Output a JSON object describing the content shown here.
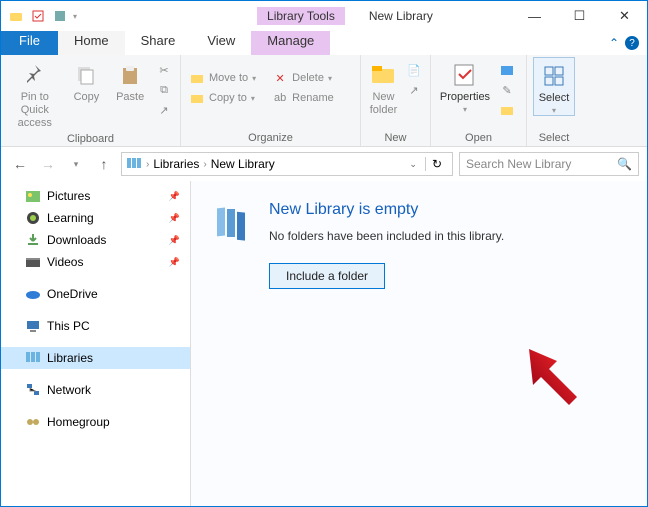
{
  "titlebar": {
    "context_tab": "Library Tools",
    "window_title": "New Library"
  },
  "tabs": {
    "file": "File",
    "home": "Home",
    "share": "Share",
    "view": "View",
    "manage": "Manage"
  },
  "ribbon": {
    "clipboard": {
      "pin": "Pin to Quick access",
      "copy": "Copy",
      "paste": "Paste",
      "label": "Clipboard"
    },
    "organize": {
      "move_to": "Move to",
      "copy_to": "Copy to",
      "delete": "Delete",
      "rename": "Rename",
      "label": "Organize"
    },
    "new": {
      "new_folder": "New folder",
      "label": "New"
    },
    "open": {
      "properties": "Properties",
      "label": "Open"
    },
    "select": {
      "select": "Select",
      "label": "Select"
    }
  },
  "nav": {
    "crumb1": "Libraries",
    "crumb2": "New Library",
    "search_placeholder": "Search New Library"
  },
  "sidebar": {
    "pictures": "Pictures",
    "learning": "Learning",
    "downloads": "Downloads",
    "videos": "Videos",
    "onedrive": "OneDrive",
    "thispc": "This PC",
    "libraries": "Libraries",
    "network": "Network",
    "homegroup": "Homegroup"
  },
  "main": {
    "heading": "New Library is empty",
    "subtext": "No folders have been included in this library.",
    "button": "Include a folder"
  }
}
